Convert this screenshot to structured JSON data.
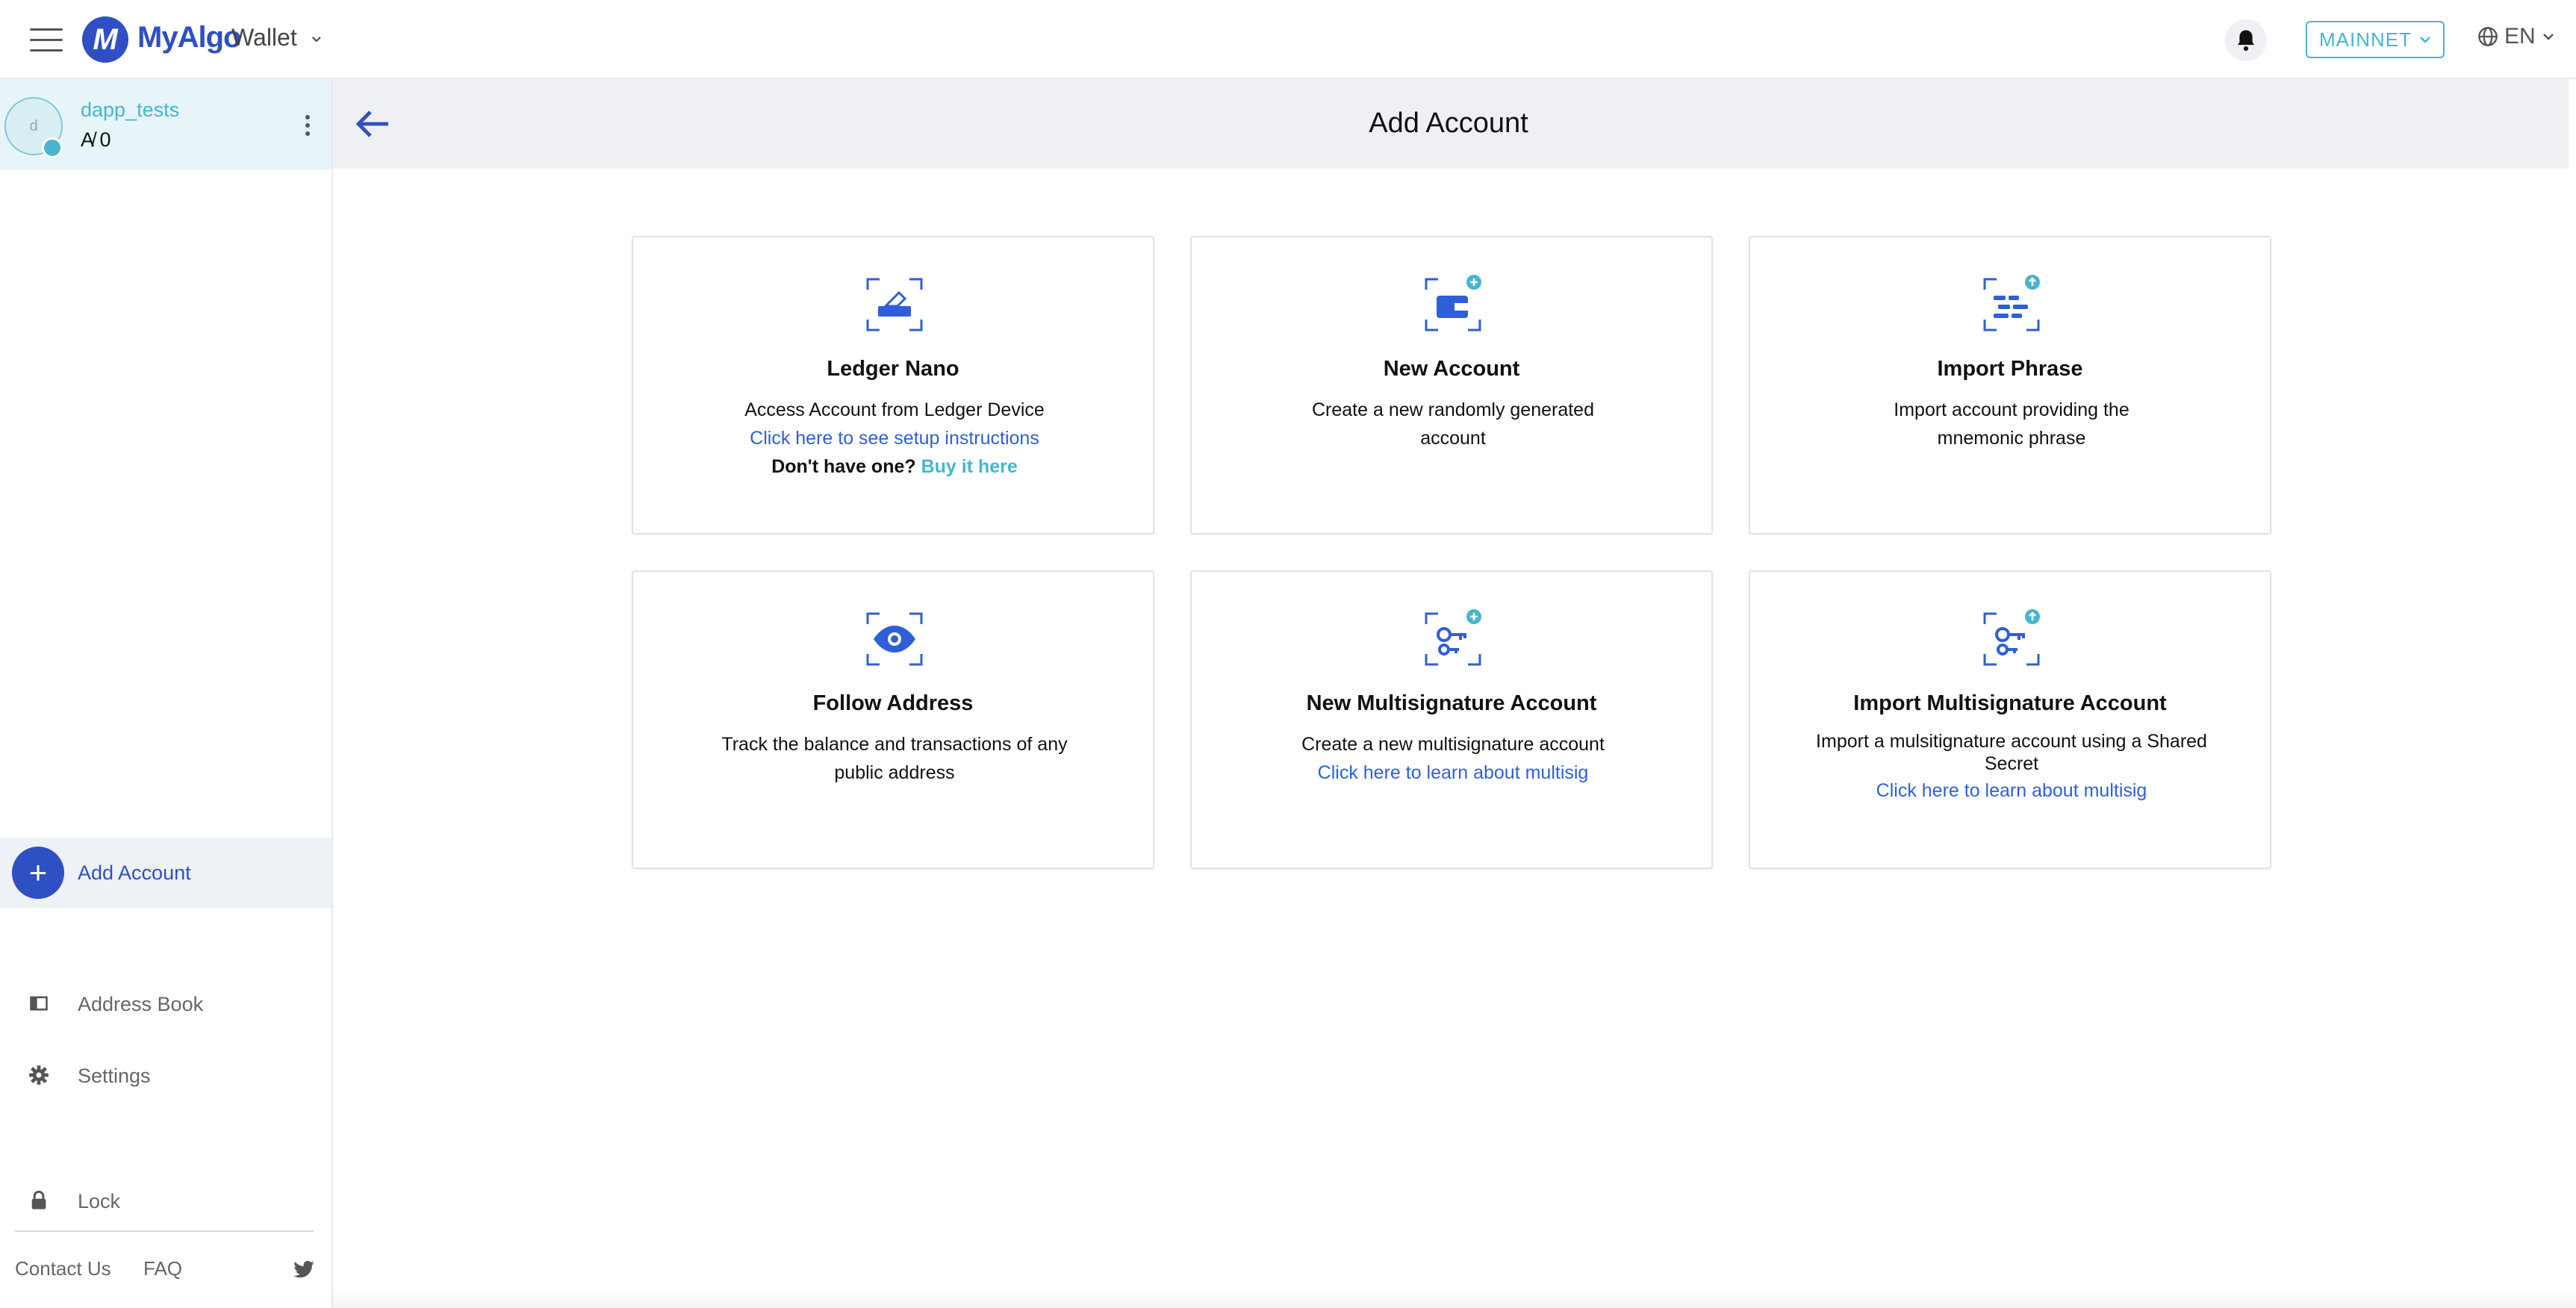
{
  "topbar": {
    "logo_letter": "M",
    "logo_text": "MyAlgo",
    "product": "Wallet",
    "network": "MAINNET",
    "language": "EN"
  },
  "sidebar": {
    "account": {
      "avatar_letter": "d",
      "name": "dapp_tests",
      "balance": "A̸ 0"
    },
    "add_account": "Add Account",
    "nav": [
      {
        "label": "Address Book",
        "icon": "address-book-icon"
      },
      {
        "label": "Settings",
        "icon": "gear-icon"
      },
      {
        "label": "Lock",
        "icon": "lock-icon"
      }
    ],
    "footer": {
      "contact": "Contact Us",
      "faq": "FAQ"
    }
  },
  "main": {
    "title": "Add Account",
    "cards": [
      {
        "title": "Ledger Nano",
        "desc": "Access Account from Ledger Device",
        "link": "Click here to see setup instructions",
        "extra_q": "Don't have one?",
        "extra_link": "Buy it here",
        "icon": "ledger-icon"
      },
      {
        "title": "New Account",
        "desc": "Create a new randomly generated account",
        "icon": "wallet-plus-icon"
      },
      {
        "title": "Import Phrase",
        "desc": "Import account providing the mnemonic phrase",
        "icon": "phrase-import-icon"
      },
      {
        "title": "Follow Address",
        "desc": "Track the balance and transactions of any public address",
        "icon": "eye-icon"
      },
      {
        "title": "New Multisignature Account",
        "desc": "Create a new multisignature account",
        "link": "Click here to learn about multisig",
        "icon": "keys-plus-icon"
      },
      {
        "title": "Import Multisignature Account",
        "desc": "Import a mulsitignature account using a Shared Secret",
        "link": "Click here to learn about multisig",
        "icon": "keys-import-icon"
      }
    ]
  },
  "colors": {
    "primary": "#2f4fc4",
    "accent": "#47b5cf",
    "link": "#2f5fd8"
  }
}
